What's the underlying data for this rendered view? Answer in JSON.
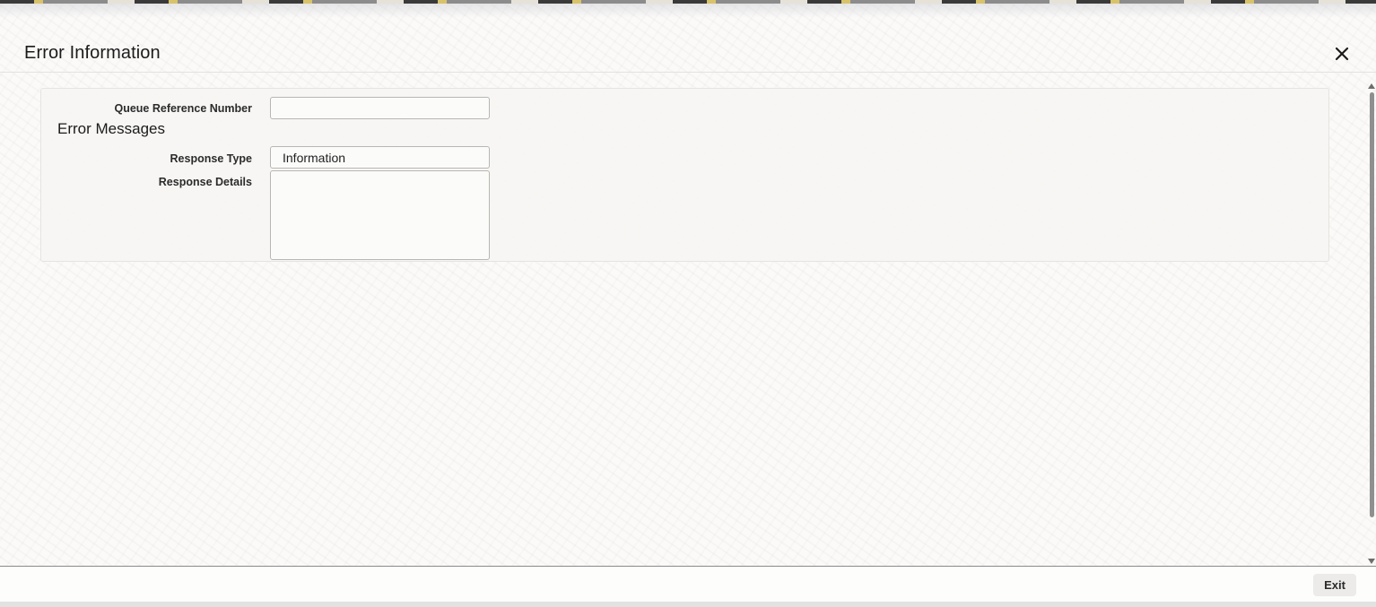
{
  "dialog": {
    "title": "Error Information"
  },
  "form": {
    "queue_reference_label": "Queue Reference Number",
    "queue_reference_value": "",
    "section_heading": "Error Messages",
    "response_type_label": "Response Type",
    "response_type_value": "Information",
    "response_details_label": "Response Details",
    "response_details_value": ""
  },
  "footer": {
    "exit_label": "Exit"
  },
  "icons": {
    "close": "close-icon"
  },
  "colors": {
    "text": "#1b1b1b",
    "panel_background": "#f6f5f3",
    "field_border": "#b8b6b2",
    "exit_button_background": "#ecebea"
  }
}
